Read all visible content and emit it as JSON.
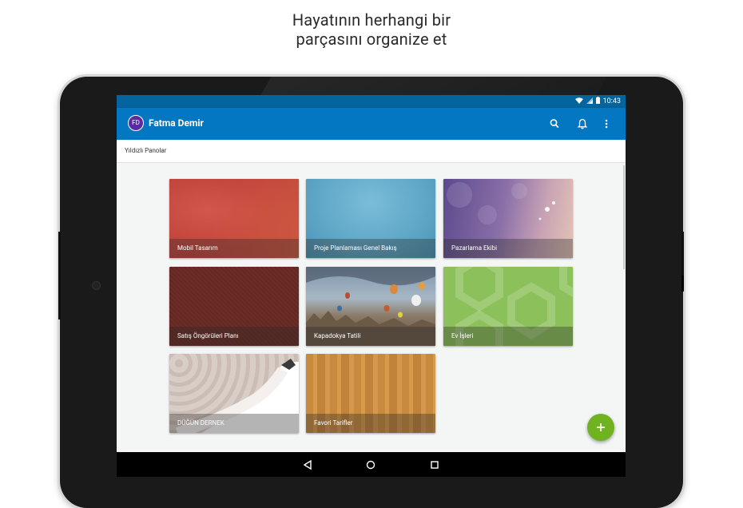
{
  "promo": {
    "line1": "Hayatının herhangi bir",
    "line2": "parçasını organize et"
  },
  "statusbar": {
    "time": "10:43"
  },
  "appbar": {
    "avatar_initials": "FD",
    "username": "Fatma Demir"
  },
  "subheader": {
    "title": "Yıldızlı Panolar"
  },
  "boards": [
    {
      "label": "Mobil Tasarım"
    },
    {
      "label": "Proje Planlaması Genel Bakış"
    },
    {
      "label": "Pazarlama Ekibi"
    },
    {
      "label": "Satış Öngörüleri Planı"
    },
    {
      "label": "Kapadokya Tatili"
    },
    {
      "label": "Ev İşleri"
    },
    {
      "label": "DÜĞÜN DERNEK"
    },
    {
      "label": "Favori Tarifler"
    }
  ],
  "fab": {
    "glyph": "+"
  },
  "colors": {
    "appbar": "#0377c2",
    "statusbar": "#04649e",
    "fab": "#6fb320"
  }
}
